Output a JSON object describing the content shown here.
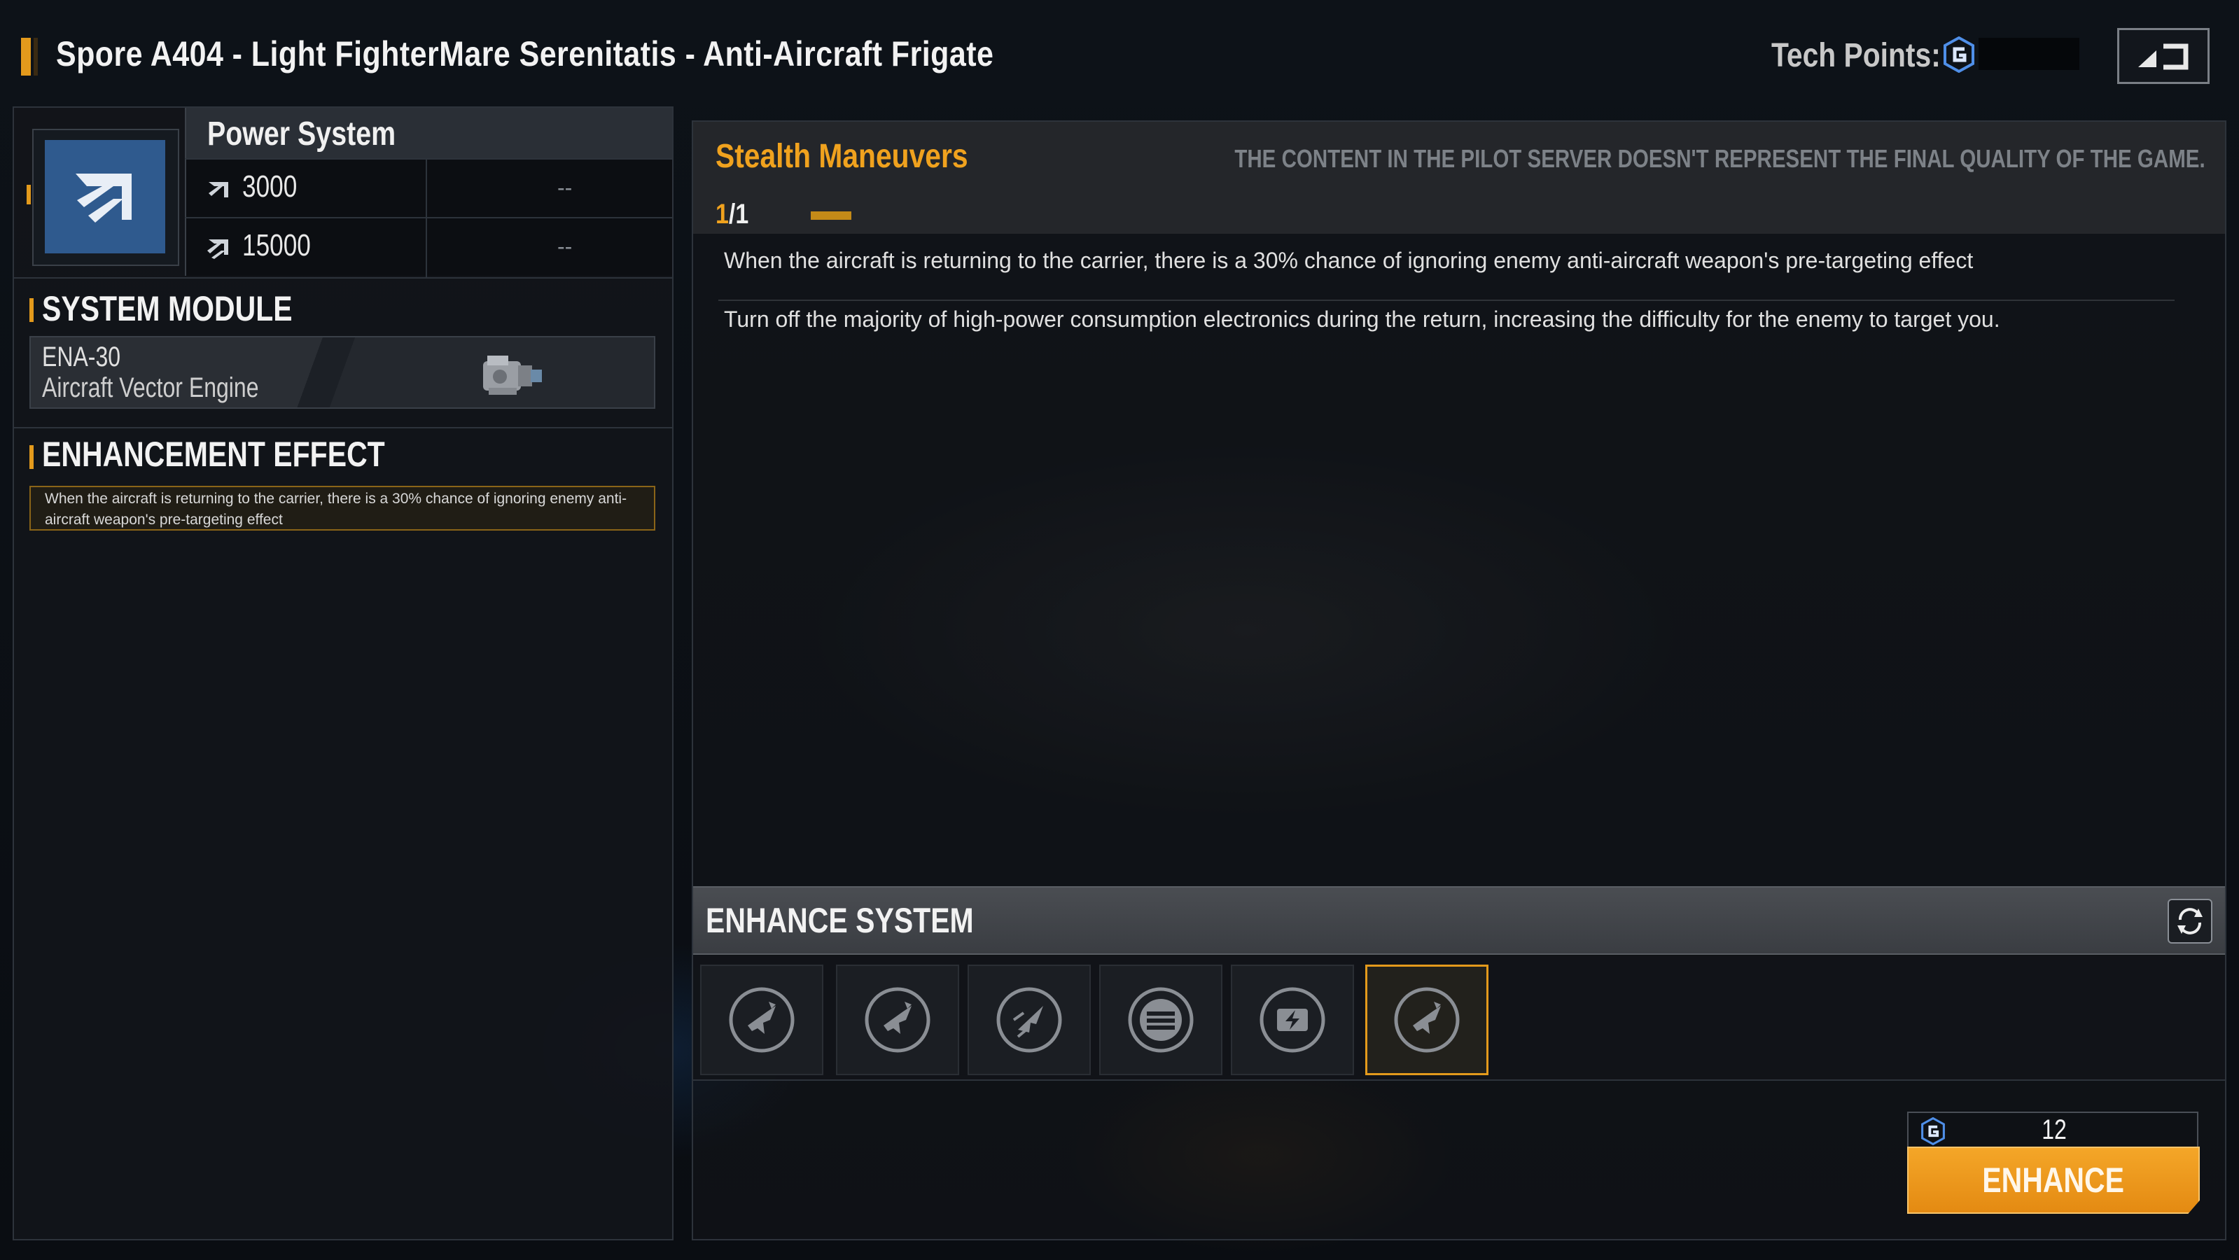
{
  "header": {
    "title": "Spore A404 - Light FighterMare Serenitatis - Anti-Aircraft Frigate",
    "tech_points_label": "Tech Points:",
    "tech_points_value": "",
    "back_icon": "back-arrow-icon"
  },
  "power_system": {
    "title": "Power System",
    "icon": "power-system-icon",
    "rows": [
      {
        "icon": "thrust-icon",
        "value": "3000",
        "secondary": "--"
      },
      {
        "icon": "thrust-double-icon",
        "value": "15000",
        "secondary": "--"
      }
    ]
  },
  "system_module": {
    "heading": "SYSTEM MODULE",
    "code": "ENA-30",
    "name": "Aircraft Vector Engine",
    "icon": "engine-icon"
  },
  "enhancement_effect": {
    "heading": "ENHANCEMENT EFFECT",
    "text": "When the aircraft is returning to the carrier, there is a 30% chance of ignoring enemy anti-aircraft weapon's pre-targeting effect"
  },
  "skill": {
    "name": "Stealth Maneuvers",
    "disclaimer": "THE CONTENT IN THE PILOT SERVER DOESN'T REPRESENT THE FINAL QUALITY OF THE GAME.",
    "level_current": "1",
    "level_max": "/1",
    "description": "When the aircraft is returning to the carrier, there is a 30% chance of ignoring enemy anti-aircraft weapon's pre-targeting effect",
    "flavor": "Turn off the majority of high-power consumption electronics during the return, increasing the difficulty for the enemy to target you."
  },
  "enhance_system": {
    "heading": "ENHANCE SYSTEM",
    "refresh_icon": "refresh-icon",
    "slots": [
      {
        "icon": "aircraft-stealth-icon",
        "selected": false
      },
      {
        "icon": "aircraft-stealth-icon",
        "selected": false
      },
      {
        "icon": "aircraft-speed-icon",
        "selected": false
      },
      {
        "icon": "stack-icon",
        "selected": false
      },
      {
        "icon": "battery-bolt-icon",
        "selected": false
      },
      {
        "icon": "aircraft-stealth-icon",
        "selected": true
      }
    ],
    "cost": "12",
    "enhance_label": "ENHANCE"
  },
  "colors": {
    "accent": "#e39a1c",
    "skill_name": "#f0a21e",
    "icon_blue": "#2f5a8e",
    "tech_blue": "#4f8fe8"
  }
}
